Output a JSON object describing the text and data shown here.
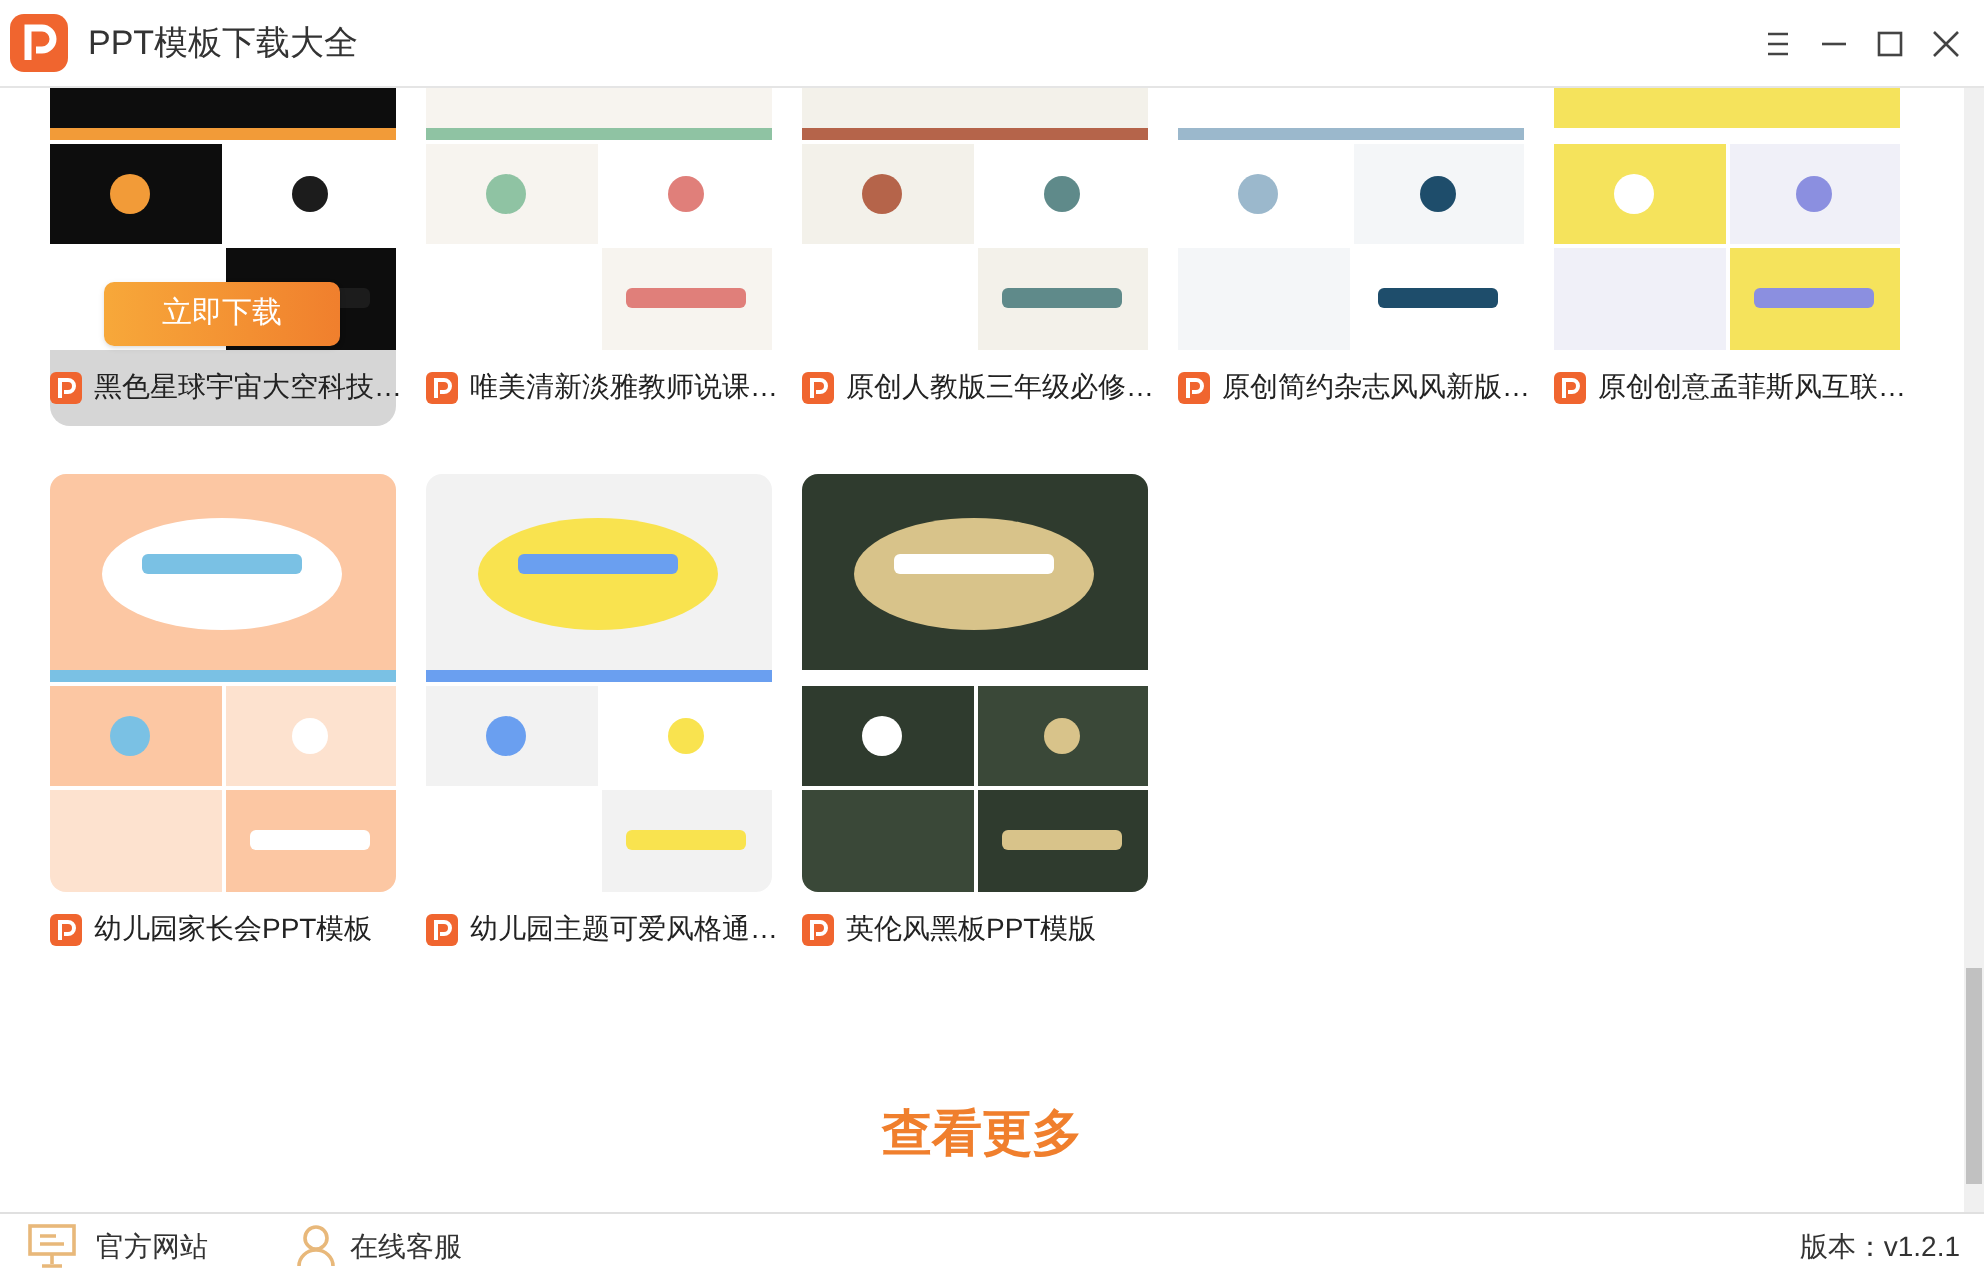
{
  "window": {
    "title": "PPT模板下载大全"
  },
  "templates": [
    {
      "title": "黑色星球宇宙大空科技…",
      "hovered": true,
      "action": "立即下载"
    },
    {
      "title": "唯美清新淡雅教师说课…",
      "hovered": false
    },
    {
      "title": "原创人教版三年级必修…",
      "hovered": false
    },
    {
      "title": "原创简约杂志风风新版…",
      "hovered": false
    },
    {
      "title": "原创创意孟菲斯风互联…",
      "hovered": false
    },
    {
      "title": "幼儿园家长会PPT模板",
      "hovered": false
    },
    {
      "title": "幼儿园主题可爱风格通…",
      "hovered": false
    },
    {
      "title": "英伦风黑板PPT模版",
      "hovered": false
    }
  ],
  "more_button": "查看更多",
  "status_bar": {
    "links": [
      {
        "kind": "website",
        "label": "官方网站"
      },
      {
        "kind": "support",
        "label": "在线客服"
      }
    ],
    "version": "版本：v1.2.1"
  }
}
